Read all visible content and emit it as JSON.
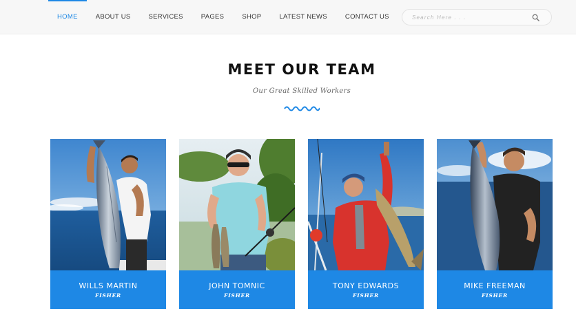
{
  "nav": {
    "items": [
      {
        "label": "HOME",
        "active": true
      },
      {
        "label": "ABOUT US"
      },
      {
        "label": "SERVICES"
      },
      {
        "label": "PAGES"
      },
      {
        "label": "SHOP"
      },
      {
        "label": "LATEST NEWS"
      },
      {
        "label": "CONTACT US"
      }
    ],
    "active_color": "#1e88e5"
  },
  "search": {
    "placeholder": "Search Here . . .",
    "icon": "search-icon"
  },
  "section": {
    "title": "MEET OUR TEAM",
    "subtitle": "Our Great Skilled Workers",
    "divider_icon": "wave-icon",
    "accent": "#1e88e5"
  },
  "team": [
    {
      "name": "WILLS MARTIN",
      "role": "FISHER"
    },
    {
      "name": "JOHN TOMNIC",
      "role": "FISHER"
    },
    {
      "name": "TONY EDWARDS",
      "role": "FISHER"
    },
    {
      "name": "MIKE FREEMAN",
      "role": "FISHER"
    }
  ]
}
